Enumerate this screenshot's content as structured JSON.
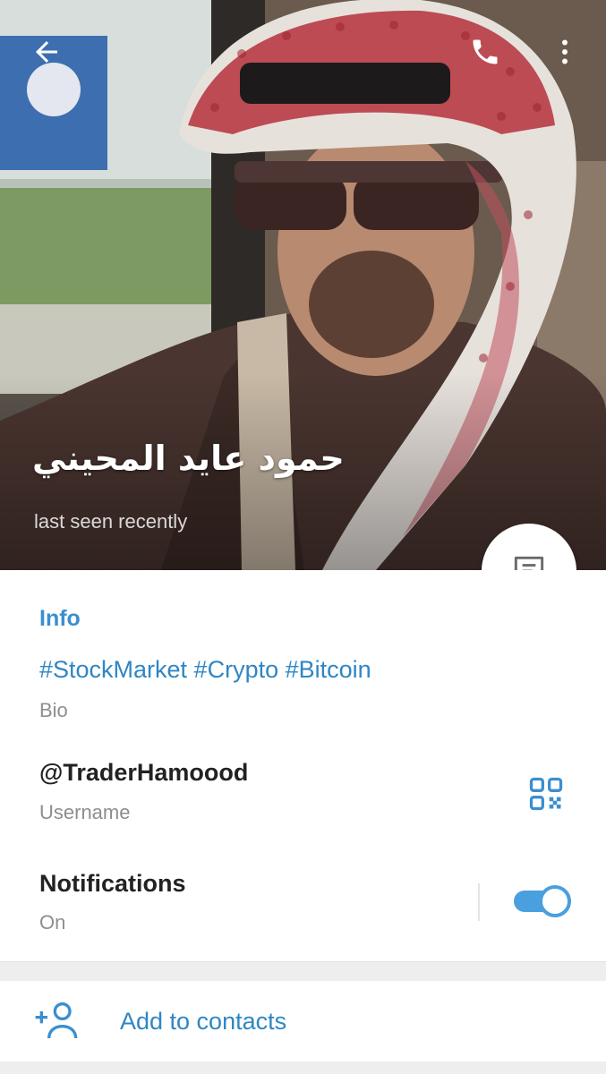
{
  "header": {
    "back_icon": "arrow-left-icon",
    "call_icon": "phone-icon",
    "more_icon": "more-vertical-icon",
    "name": "حمود عايد المحيني",
    "status": "last seen recently",
    "message_icon": "message-icon"
  },
  "info": {
    "title": "Info",
    "bio": {
      "value": "#StockMarket #Crypto #Bitcoin",
      "label": "Bio"
    },
    "username": {
      "value": "@TraderHamoood",
      "label": "Username",
      "icon": "qr-code-icon"
    },
    "notifications": {
      "value": "Notifications",
      "label": "On",
      "enabled": true
    }
  },
  "actions": {
    "add_contact": {
      "label": "Add to contacts",
      "icon": "add-user-icon"
    }
  },
  "colors": {
    "accent": "#3a8fd0",
    "toggle": "#4a9fdf",
    "divider": "#eeeeee"
  }
}
